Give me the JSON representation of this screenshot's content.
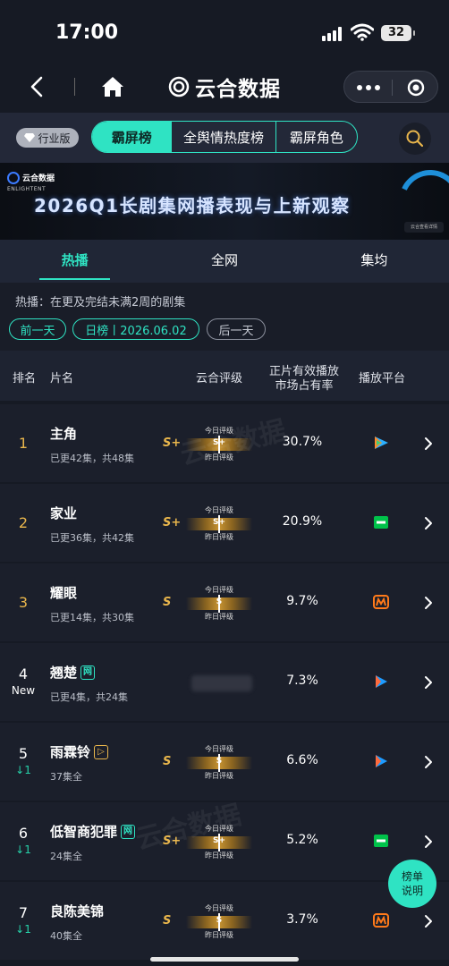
{
  "status_bar": {
    "time": "17:00",
    "battery": "32"
  },
  "nav": {
    "brand": "云合数据"
  },
  "top_tabs": {
    "industry_label": "行业版",
    "items": [
      "霸屏榜",
      "全舆情热度榜",
      "霸屏角色"
    ],
    "active": 0
  },
  "banner": {
    "logo_cn": "云合数据",
    "logo_en": "ENLIGHTENT",
    "title": "2026Q1长剧集网播表现与上新观察",
    "badge": "云合查看详情"
  },
  "sub_tabs": {
    "items": [
      "热播",
      "全网",
      "集均"
    ],
    "active": 0
  },
  "info": {
    "description": "热播：在更及完结未满2周的剧集",
    "prev_day": "前一天",
    "date_label": "日榜丨2026.06.02",
    "next_day": "后一天"
  },
  "table": {
    "headers": {
      "rank": "排名",
      "title": "片名",
      "grade": "云合评级",
      "share_line1": "正片有效播放",
      "share_line2": "市场占有率",
      "platform": "播放平台"
    },
    "meter_labels": {
      "today": "今日评级",
      "yesterday": "昨日评级"
    },
    "rows": [
      {
        "rank": "1",
        "tag": "",
        "title": "主角",
        "badge": "",
        "sub": "已更42集，共48集",
        "grade": "S+",
        "share": "30.7%",
        "platform": "tencent"
      },
      {
        "rank": "2",
        "tag": "",
        "title": "家业",
        "badge": "",
        "sub": "已更36集，共42集",
        "grade": "S+",
        "share": "20.9%",
        "platform": "iqiyi"
      },
      {
        "rank": "3",
        "tag": "",
        "title": "耀眼",
        "badge": "",
        "sub": "已更14集，共30集",
        "grade": "S",
        "share": "9.7%",
        "platform": "mango"
      },
      {
        "rank": "4",
        "tag": "New",
        "title": "翘楚",
        "badge": "网",
        "sub": "已更4集，共24集",
        "grade": "",
        "share": "7.3%",
        "platform": "youku"
      },
      {
        "rank": "5",
        "tag": "↓1",
        "title": "雨霖铃",
        "badge": "play",
        "sub": "37集全",
        "grade": "S",
        "share": "6.6%",
        "platform": "youku"
      },
      {
        "rank": "6",
        "tag": "↓1",
        "title": "低智商犯罪",
        "badge": "网",
        "sub": "24集全",
        "grade": "S+",
        "share": "5.2%",
        "platform": "iqiyi"
      },
      {
        "rank": "7",
        "tag": "↓1",
        "title": "良陈美锦",
        "badge": "",
        "sub": "40集全",
        "grade": "S",
        "share": "3.7%",
        "platform": "mango"
      }
    ]
  },
  "float_button": {
    "line1": "榜单",
    "line2": "说明"
  },
  "colors": {
    "accent": "#2fe3c3",
    "gold": "#e9b64c",
    "background": "#161a24"
  }
}
